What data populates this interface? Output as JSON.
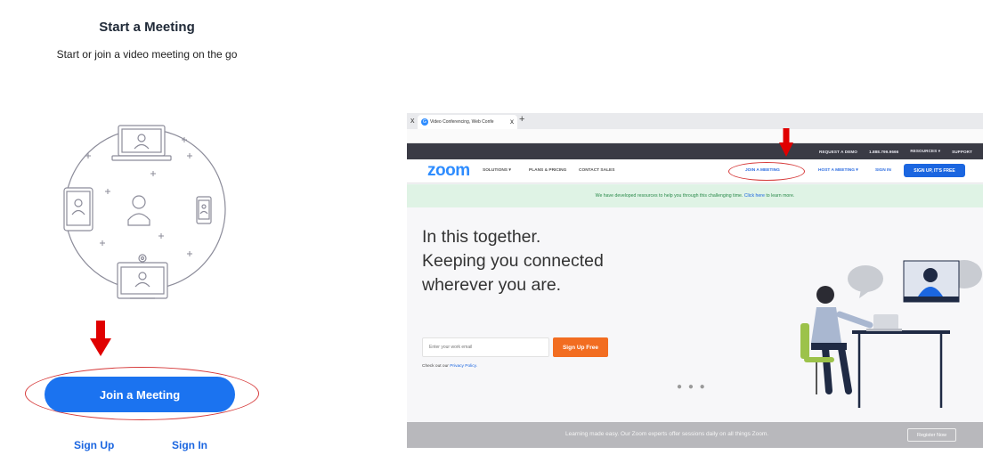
{
  "mobile": {
    "title": "Start a Meeting",
    "subtitle": "Start or join a video meeting on the go",
    "join_button": "Join a Meeting",
    "sign_up": "Sign Up",
    "sign_in": "Sign In",
    "illustration_icon": "meeting-devices-illustration"
  },
  "browser": {
    "tab_title": "Video Conferencing, Web Confe",
    "tab_close": "x",
    "tab_new": "+",
    "window_close": "x",
    "topbar": [
      "REQUEST A DEMO",
      "1.888.799.9666",
      "RESOURCES ▾",
      "SUPPORT"
    ],
    "logo": "zoom",
    "nav_left": [
      "SOLUTIONS ▾",
      "PLANS & PRICING",
      "CONTACT SALES"
    ],
    "nav_right": [
      "JOIN A MEETING",
      "HOST A MEETING ▾",
      "SIGN IN"
    ],
    "nav_cta": "SIGN UP, IT'S FREE",
    "banner_text": "We have developed resources to help you through this challenging time.",
    "banner_link": "Click here",
    "banner_tail": "to learn more.",
    "hero_lines": [
      "In this together.",
      "Keeping you connected",
      "wherever you are."
    ],
    "email_placeholder": "Enter your work email",
    "signup_button": "Sign Up Free",
    "privacy_prefix": "Check out our",
    "privacy_link": "Privacy Policy.",
    "carousel_dots": "● ● ●",
    "footer_text": "Learning made easy. Our Zoom experts offer sessions daily on all things Zoom.",
    "register_button": "Register Now"
  },
  "colors": {
    "accent_blue": "#1b73f0",
    "annotation_red": "#e00000",
    "cta_orange": "#f26d21",
    "banner_green": "#dff3e5"
  }
}
